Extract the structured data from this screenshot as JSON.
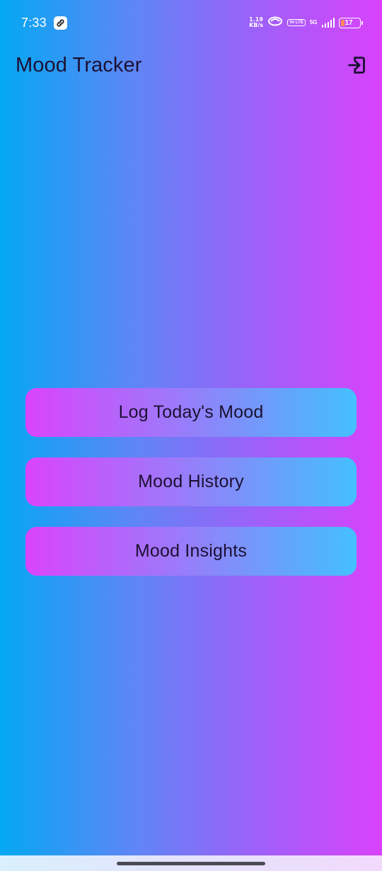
{
  "status_bar": {
    "time": "7:33",
    "net_speed_value": "1.19",
    "net_speed_unit": "KB/s",
    "volte": "Vo LTE",
    "network_type": "5G",
    "battery_level": "17"
  },
  "app_bar": {
    "title": "Mood Tracker",
    "exit_icon": "logout-icon"
  },
  "menu": {
    "items": [
      {
        "label": "Log Today's Mood"
      },
      {
        "label": "Mood History"
      },
      {
        "label": "Mood Insights"
      }
    ]
  },
  "colors": {
    "background_left": "#04a8f2",
    "background_right": "#d942fb",
    "button_left": "#da44fb",
    "button_right": "#44c0fe",
    "text_dark": "#1c1033"
  }
}
